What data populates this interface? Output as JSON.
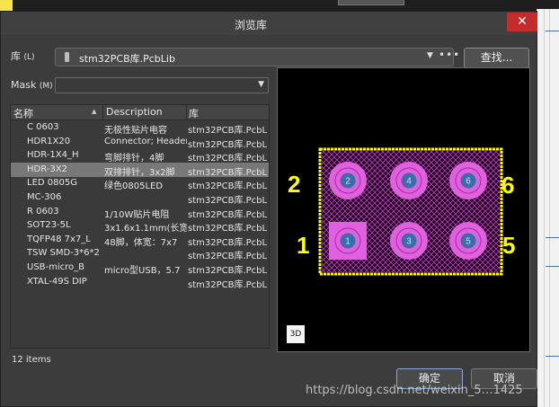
{
  "window": {
    "title": "浏览库",
    "close_glyph": "✕"
  },
  "library": {
    "label": "库",
    "hotkey": "(L)",
    "selected": "stm32PCB库.PcbLib",
    "find_button": "查找..."
  },
  "mask": {
    "label": "Mask",
    "hotkey": "(M)",
    "value": ""
  },
  "table": {
    "columns": [
      "名称",
      "Description",
      "库"
    ],
    "rows": [
      {
        "name": "C 0603",
        "description": "无极性贴片电容",
        "library": "stm32PCB库.PcbL"
      },
      {
        "name": "HDR1X20",
        "description": "Connector; Header",
        "library": "stm32PCB库.PcbL"
      },
      {
        "name": "HDR-1X4_H",
        "description": "弯脚排针，4脚",
        "library": "stm32PCB库.PcbL"
      },
      {
        "name": "HDR-3X2",
        "description": "双排排针，3x2脚",
        "library": "stm32PCB库.PcbL"
      },
      {
        "name": "LED 0805G",
        "description": "绿色0805LED",
        "library": "stm32PCB库.PcbL"
      },
      {
        "name": "MC-306",
        "description": "",
        "library": "stm32PCB库.PcbL"
      },
      {
        "name": "R 0603",
        "description": "1/10W贴片电阻",
        "library": "stm32PCB库.PcbL"
      },
      {
        "name": "SOT23-5L",
        "description": "3x1.6x1.1mm(长宽",
        "library": "stm32PCB库.PcbL"
      },
      {
        "name": "TQFP48 7x7_L",
        "description": "48脚，体宽：7x7",
        "library": "stm32PCB库.PcbL"
      },
      {
        "name": "TSW SMD-3*6*2",
        "description": "",
        "library": "stm32PCB库.PcbL"
      },
      {
        "name": "USB-micro_B",
        "description": "micro型USB，5.7",
        "library": "stm32PCB库.PcbL"
      },
      {
        "name": "XTAL-49S DIP",
        "description": "",
        "library": "stm32PCB库.PcbL"
      }
    ],
    "selected_row": "HDR-3X2"
  },
  "status": {
    "items_count": "12 items"
  },
  "preview": {
    "pad_numbers_top": [
      "2",
      "4",
      "6"
    ],
    "pad_numbers_bottom": [
      "1",
      "3",
      "5"
    ],
    "pin_labels": {
      "top_left": "2",
      "top_right": "6",
      "bottom_left": "1",
      "bottom_right": "5"
    },
    "mode_button": "3D",
    "colors": {
      "outline": "#ffff00",
      "pad": "#e060e0",
      "hole": "#3a6ea8",
      "hatch": "#c040c0"
    }
  },
  "buttons": {
    "ok": "确定",
    "cancel": "取消"
  },
  "watermark": "https://blog.csdn.net/weixin_5…1425"
}
